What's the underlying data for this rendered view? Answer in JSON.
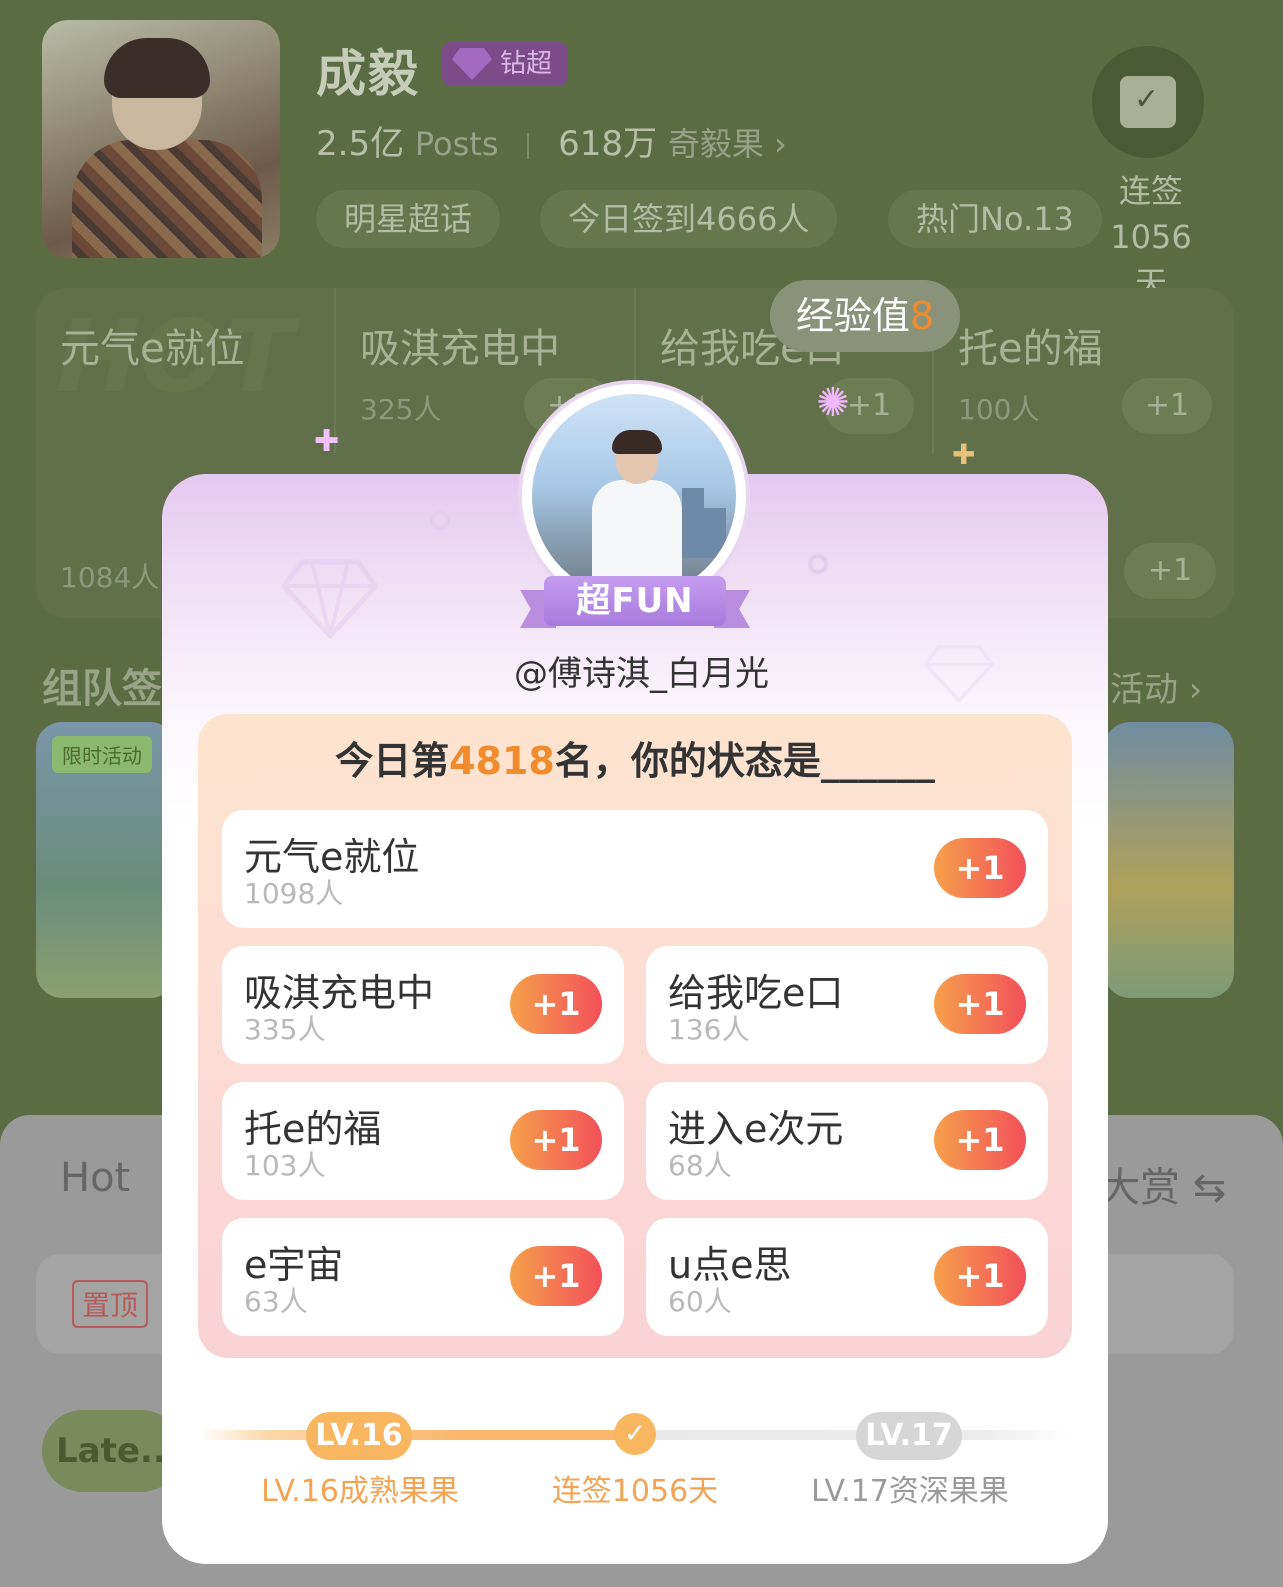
{
  "header": {
    "star_name": "成毅",
    "vip_label": "钻超",
    "posts_value": "2.5亿",
    "posts_label": "Posts",
    "fans_value": "618万",
    "fans_label": "奇毅果 ›",
    "pills": [
      "明星超话",
      "今日签到4666人",
      "热门No.13"
    ],
    "checkin_label": "连签",
    "checkin_days": "1056天"
  },
  "bg_grid": {
    "hot_watermark": "HOT",
    "cells": [
      {
        "title": "元气e就位",
        "count": "1084人",
        "plus": "+1"
      },
      {
        "title": "吸淇充电中",
        "count": "325人",
        "plus": "+1"
      },
      {
        "title": "给我吃e口",
        "count": "…人",
        "plus": "+1"
      },
      {
        "title": "托e的福",
        "count": "100人",
        "plus": "+1"
      }
    ],
    "exp_label": "经验值",
    "exp_value": "8"
  },
  "team": {
    "title": "组队签",
    "activity_link": "活动 ›",
    "limited_tag": "限时活动"
  },
  "bottom_sheet": {
    "hot_tab": "Hot",
    "reward_tab": "大赏 ⇆",
    "top_tag": "置顶",
    "latest_tab": "Late.."
  },
  "popup": {
    "badge": "超FUN",
    "username": "@傅诗淇_白月光",
    "question_prefix": "今日第",
    "rank": "4818",
    "question_suffix": "名，你的状态是______",
    "options": [
      {
        "name": "元气e就位",
        "count": "1098人",
        "plus": "+1"
      },
      {
        "name": "吸淇充电中",
        "count": "335人",
        "plus": "+1"
      },
      {
        "name": "给我吃e口",
        "count": "136人",
        "plus": "+1"
      },
      {
        "name": "托e的福",
        "count": "103人",
        "plus": "+1"
      },
      {
        "name": "进入e次元",
        "count": "68人",
        "plus": "+1"
      },
      {
        "name": "e宇宙",
        "count": "63人",
        "plus": "+1"
      },
      {
        "name": "u点e思",
        "count": "60人",
        "plus": "+1"
      }
    ],
    "level": {
      "current_chip": "LV.16",
      "current_label": "LV.16成熟果果",
      "streak_label": "连签1056天",
      "next_chip": "LV.17",
      "next_label": "LV.17资深果果"
    }
  },
  "colors": {
    "accent_orange": "#f08c2e",
    "plus_gradient_start": "#f6a04c",
    "plus_gradient_end": "#f2505a",
    "badge_purple": "#b98ee0"
  }
}
